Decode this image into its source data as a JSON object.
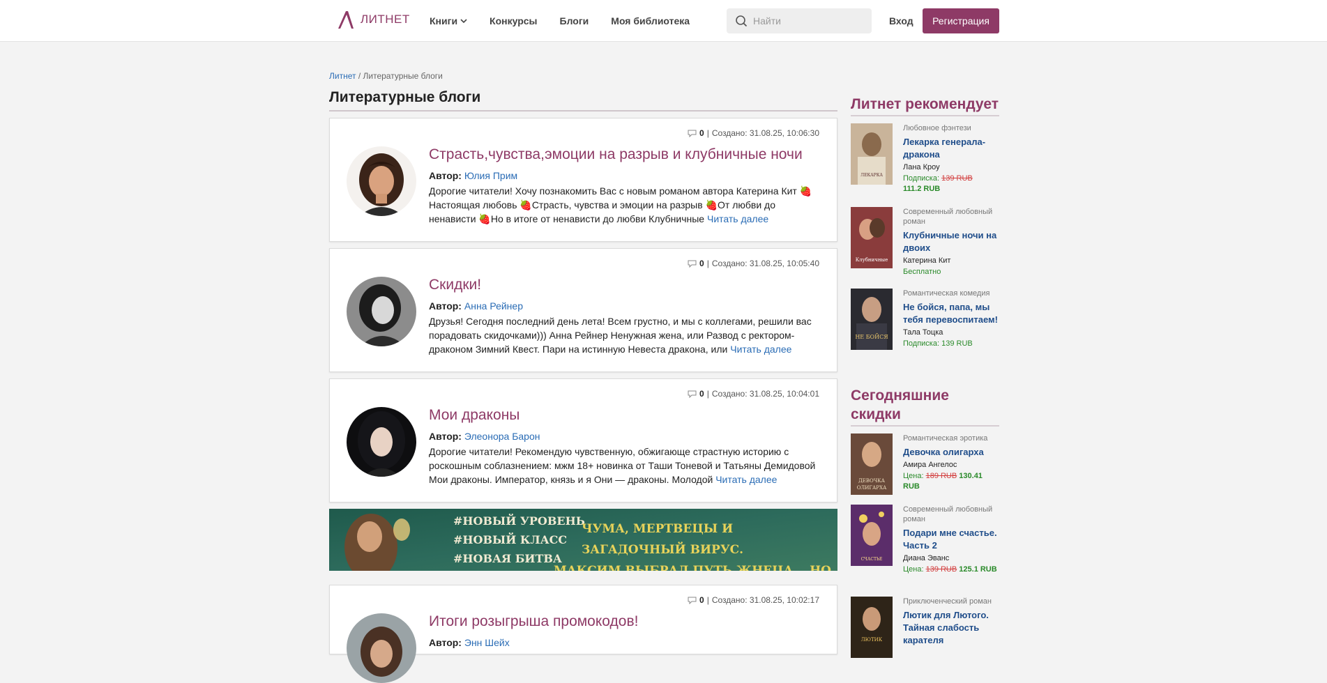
{
  "header": {
    "logo_text": "ЛИТНЕТ",
    "nav": [
      "Книги",
      "Конкурсы",
      "Блоги",
      "Моя библиотека"
    ],
    "search_placeholder": "Найти",
    "login": "Вход",
    "register": "Регистрация"
  },
  "breadcrumb": {
    "home": "Литнет",
    "separator": "/",
    "current": "Литературные блоги"
  },
  "page_title": "Литературные блоги",
  "posts": [
    {
      "comments": "0",
      "created": "Создано: 31.08.25, 10:06:30",
      "title": "Страсть,чувства,эмоции на разрыв и клубничные ночи",
      "author_label": "Автор:",
      "author": "Юлия Прим",
      "text": "Дорогие читатели!  Хочу познакомить Вас с новым романом автора Катерина Кит 🍓Настоящая любовь 🍓Страсть, чувства и эмоции на разрыв 🍓От любви до ненависти 🍓Но в итоге от ненависти до любви   Клубничные",
      "read_more": "Читать далее"
    },
    {
      "comments": "0",
      "created": "Создано: 31.08.25, 10:05:40",
      "title": "Скидки!",
      "author_label": "Автор:",
      "author": "Анна Рейнер",
      "text": "Друзья! Сегодня последний день лета! Всем грустно, и мы с коллегами, решили вас порадовать скидочками))) Анна Рейнер Ненужная жена, или Развод с ректором-драконом Зимний Квест. Пари на истинную Невеста дракона, или",
      "read_more": "Читать далее"
    },
    {
      "comments": "0",
      "created": "Создано: 31.08.25, 10:04:01",
      "title": "Мои драконы",
      "author_label": "Автор:",
      "author": "Элеонора Барон",
      "text": "  Дорогие читатели!  Рекомендую чувственную, обжигающе страстную историю с роскошным соблазнением: мжм 18+ новинка от Таши Тоневой и Татьяны Демидовой Мои драконы. Император, князь и я Они — драконы. Молодой",
      "read_more": "Читать далее"
    },
    {
      "comments": "0",
      "created": "Создано: 31.08.25, 10:02:17",
      "title": "Итоги розыгрыша промокодов!",
      "author_label": "Автор:",
      "author": "Энн Шейх",
      "text": "",
      "read_more": ""
    }
  ],
  "banner": {
    "left_lines": [
      "#НОВЫЙ УРОВЕНЬ",
      "#НОВЫЙ КЛАСС",
      "#НОВАЯ БИТВА"
    ],
    "right_lines": [
      "ЧУМА, МЕРТВЕЦЫ И ЗАГАДОЧНЫЙ ВИРУС.",
      "МАКСИМ ВЫБРАЛ ПУТЬ ЖНЕЦА... НО КАКОЙ ЦЕНОЙ?"
    ]
  },
  "sidebar": {
    "recommends_title": "Литнет рекомендует",
    "recommends": [
      {
        "genre": "Любовное фэнтези",
        "title": "Лекарка генерала-дракона",
        "author": "Лана Кроу",
        "price_label": "Подписка:",
        "old_price": "139 RUB",
        "new_price": "111.2 RUB",
        "cover_text": "ЛЕКАРКА ГЕНЕРАЛА ДРАКОНА"
      },
      {
        "genre": "Современный любовный роман",
        "title": "Клубничные ночи на двоих",
        "author": "Катерина Кит",
        "price_label": "Бесплатно",
        "old_price": "",
        "new_price": "",
        "cover_text": "Клубничные ночи"
      },
      {
        "genre": "Романтическая комедия",
        "title": "Не бойся, папа, мы тебя перевоспитаем!",
        "author": "Тала Тоцка",
        "price_label": "Подписка: 139 RUB",
        "old_price": "",
        "new_price": "",
        "cover_text": "НЕ БОЙСЯ ПАПА"
      }
    ],
    "discounts_title": "Сегодняшние скидки",
    "discounts": [
      {
        "genre": "Романтическая эротика",
        "title": "Девочка олигарха",
        "author": "Амира Ангелос",
        "price_label": "Цена:",
        "old_price": "189 RUB",
        "new_price": "130.41 RUB",
        "cover_text": "ДЕВОЧКА ОЛИГАРХА"
      },
      {
        "genre": "Современный любовный роман",
        "title": "Подари мне счастье. Часть 2",
        "author": "Диана Эванс",
        "price_label": "Цена:",
        "old_price": "139 RUB",
        "new_price": "125.1 RUB",
        "cover_text": "ПОДАРИ МНЕ СЧАСТЬЕ"
      },
      {
        "genre": "Приключенческий роман",
        "title": "Лютик для Лютого. Тайная слабость карателя",
        "author": "",
        "price_label": "",
        "old_price": "",
        "new_price": "",
        "cover_text": "ЛЮТИК ДЛЯ ЛЮТОГО"
      }
    ]
  },
  "colors": {
    "brand": "#8e3a66",
    "link": "#2a6cb5",
    "book_title": "#1f4d8a",
    "price_green": "#2a8a2a",
    "price_old": "#d23c3c"
  }
}
